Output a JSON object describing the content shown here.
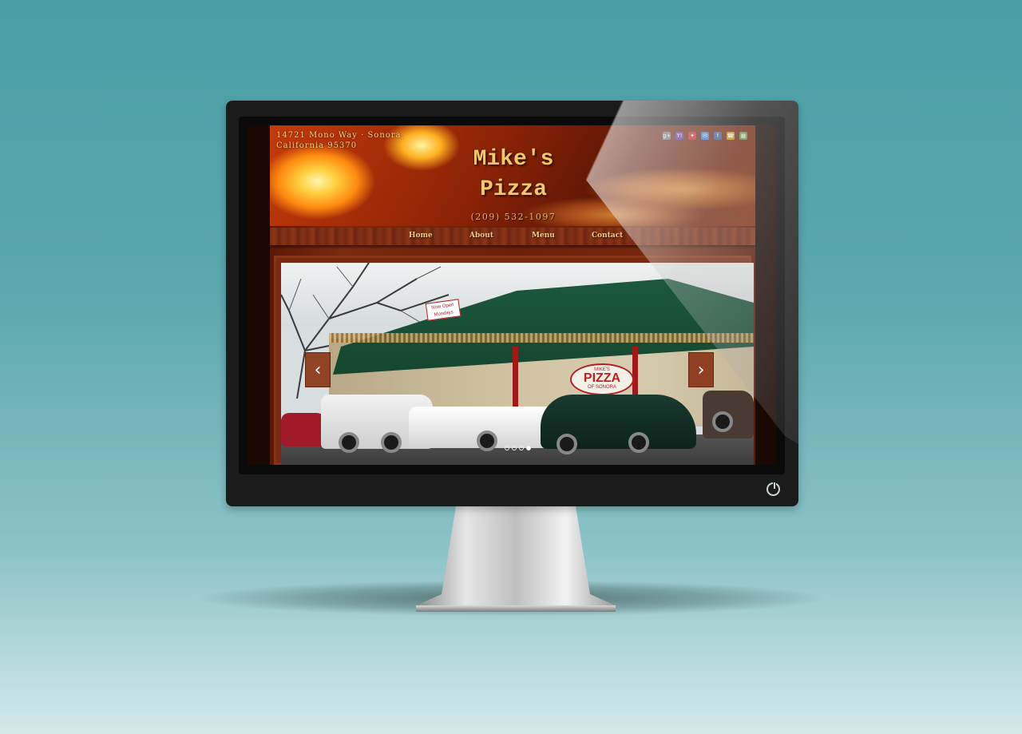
{
  "site": {
    "address_line1": "14721 Mono Way · Sonora,",
    "address_line2": "California 95370",
    "title_line1": "Mike's",
    "title_line2": "Pizza",
    "phone": "(209) 532-1097"
  },
  "social_icons": [
    {
      "name": "google-plus-icon",
      "glyph": "g+",
      "color": "#6b6b6b"
    },
    {
      "name": "yahoo-icon",
      "glyph": "Y!",
      "color": "#5b2b9a"
    },
    {
      "name": "yelp-icon",
      "glyph": "✦",
      "color": "#c42020"
    },
    {
      "name": "email-icon",
      "glyph": "✉",
      "color": "#3a7bc8"
    },
    {
      "name": "facebook-icon",
      "glyph": "f",
      "color": "#3b5998"
    },
    {
      "name": "phone-icon",
      "glyph": "☎",
      "color": "#c9a020"
    },
    {
      "name": "map-icon",
      "glyph": "▦",
      "color": "#6a9a4a"
    }
  ],
  "nav": {
    "items": [
      {
        "label": "Home"
      },
      {
        "label": "About"
      },
      {
        "label": "Menu"
      },
      {
        "label": "Contact"
      }
    ]
  },
  "slider": {
    "prev_label": "‹",
    "next_label": "›",
    "slide_count": 4,
    "active_index": 3,
    "photo": {
      "sign_small": "MIKE'S",
      "sign_big": "PIZZA",
      "sign_sub": "OF SONORA",
      "banner_text": "Now Open Mondays"
    }
  },
  "colors": {
    "accent": "#f0c870",
    "nav_text": "#f0cf8a",
    "wood": "#7a2c12"
  }
}
